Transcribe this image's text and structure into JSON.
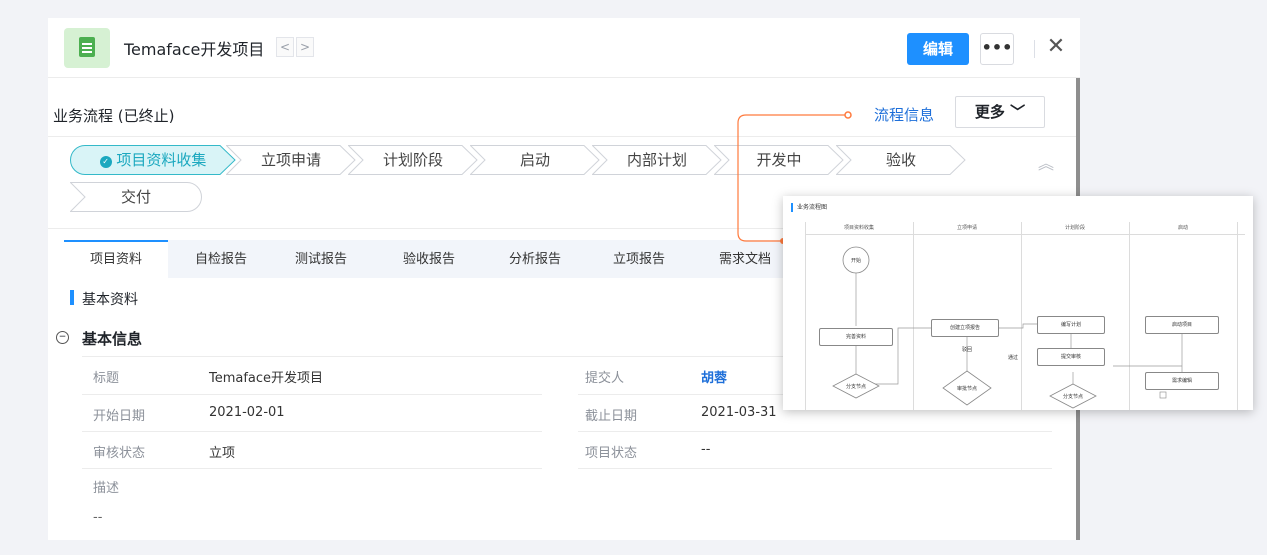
{
  "header": {
    "title": "Temaface开发项目",
    "prev": "<",
    "next": ">",
    "edit_label": "编辑",
    "more_label": "•••",
    "close_label": "✕"
  },
  "flow": {
    "title": "业务流程 (已终止)",
    "info_link": "流程信息",
    "more_label": "更多 ﹀",
    "steps": [
      "项目资料收集",
      "立项申请",
      "计划阶段",
      "启动",
      "内部计划",
      "开发中",
      "验收",
      "交付"
    ],
    "active_step": 0,
    "collapse_icon": "︽"
  },
  "tabs": [
    "项目资料",
    "自检报告",
    "测试报告",
    "验收报告",
    "分析报告",
    "立项报告",
    "需求文档"
  ],
  "section_title": "基本资料",
  "group": {
    "toggle": "−",
    "title": "基本信息"
  },
  "fields": {
    "title_label": "标题",
    "title_value": "Temaface开发项目",
    "submitter_label": "提交人",
    "submitter_value": "胡蓉",
    "start_label": "开始日期",
    "start_value": "2021-02-01",
    "end_label": "截止日期",
    "end_value": "2021-03-31",
    "review_label": "审核状态",
    "review_value": "立项",
    "status_label": "项目状态",
    "status_value": "--",
    "desc_label": "描述",
    "desc_value": "--"
  },
  "popup": {
    "title": "业务流程图",
    "lanes": [
      "项目资料收集",
      "立项申请",
      "计划阶段",
      "启动"
    ],
    "nodes": {
      "start": "开始",
      "complete": "完善资料",
      "branch1": "分支节点",
      "create": "创建立项报告",
      "reject": "驳回",
      "approve_node": "审批节点",
      "pass": "通过",
      "write_plan": "编写计划",
      "submit_review": "提交审核",
      "branch2": "分支节点",
      "launch": "启动项目",
      "req_write": "需求编辑"
    }
  },
  "colors": {
    "primary": "#1e90ff",
    "connector": "#ff7a3d",
    "active_step_bg": "#d9f4f7",
    "active_step_border": "#34b9c9"
  }
}
